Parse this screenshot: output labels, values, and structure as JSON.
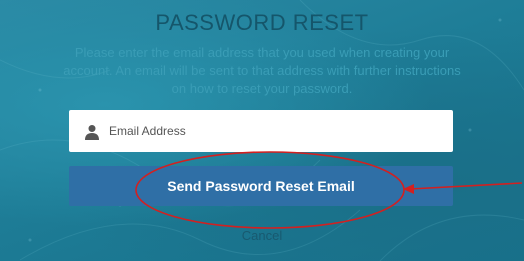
{
  "title": "PASSWORD RESET",
  "instructions": "Please enter the email address that you used when creating your account. An email will be sent to that address with further instructions on how to reset your password.",
  "email_field": {
    "placeholder": "Email Address",
    "value": ""
  },
  "send_button_label": "Send Password Reset Email",
  "cancel_label": "Cancel",
  "colors": {
    "background": "#1f7e98",
    "button": "#2f6fa6",
    "annotation": "#d32020"
  }
}
